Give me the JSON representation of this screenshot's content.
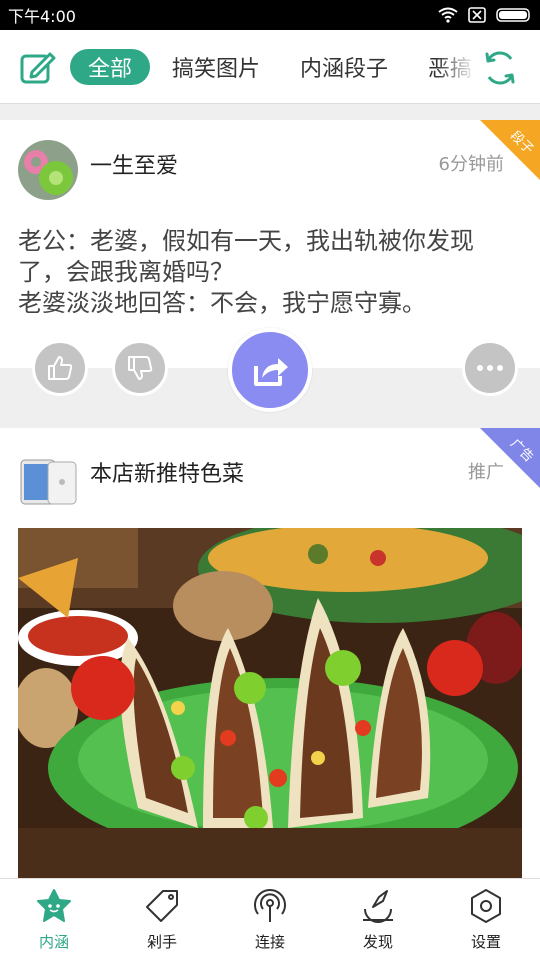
{
  "status_bar": {
    "time": "下午4:00"
  },
  "top_bar": {
    "tabs": [
      {
        "label": "全部",
        "active": true
      },
      {
        "label": "搞笑图片",
        "active": false
      },
      {
        "label": "内涵段子",
        "active": false
      },
      {
        "label": "恶搞",
        "active": false
      }
    ],
    "icons": {
      "left": "edit-icon",
      "right": "refresh-icon"
    }
  },
  "feed": [
    {
      "username": "一生至爱",
      "meta": "6分钟前",
      "corner_label": "段子",
      "corner_color": "#f5a623",
      "text": "老公：老婆，假如有一天，我出轨被你发现了，会跟我离婚吗？\n老婆淡淡地回答：不会，我宁愿守寡。",
      "actions": [
        "thumbs-up-icon",
        "thumbs-down-icon",
        "share-icon",
        "more-icon"
      ]
    },
    {
      "username": "本店新推特色菜",
      "meta": "推广",
      "corner_label": "广告",
      "corner_color": "#7f86e8"
    }
  ],
  "bottom_nav": {
    "items": [
      {
        "label": "内涵",
        "icon": "star-home-icon",
        "active": true
      },
      {
        "label": "剁手",
        "icon": "tag-icon",
        "active": false
      },
      {
        "label": "连接",
        "icon": "broadcast-icon",
        "active": false
      },
      {
        "label": "发现",
        "icon": "discover-icon",
        "active": false
      },
      {
        "label": "设置",
        "icon": "settings-icon",
        "active": false
      }
    ]
  },
  "colors": {
    "accent": "#2fa888",
    "share": "#8a8cf1",
    "ad": "#7f86e8",
    "joke": "#f5a623"
  }
}
